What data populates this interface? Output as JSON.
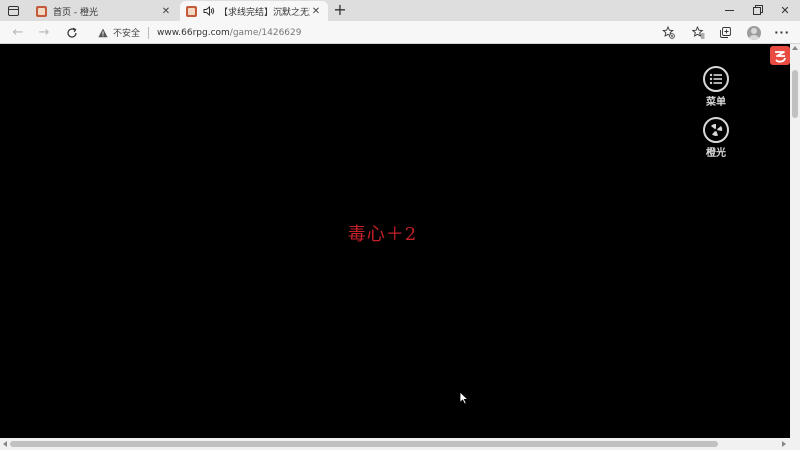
{
  "browser": {
    "tabs": [
      {
        "title": "首页 - 橙光",
        "icon": "orange-light-favicon",
        "active": false
      },
      {
        "title": "【求线完结】沉默之无双",
        "icon": "game-favicon",
        "active": true,
        "audio": true
      }
    ],
    "close_glyph": "✕",
    "new_tab_glyph": "+",
    "window_close_glyph": "✕"
  },
  "toolbar": {
    "back_glyph": "←",
    "forward_glyph": "→",
    "insecure_label": "不安全",
    "url_host": "www.66rpg.com",
    "url_path": "/game/1426629",
    "more_glyph": "···"
  },
  "game": {
    "message": "毒心＋2",
    "message_color": "#c4202a",
    "side_menu_label": "菜单",
    "side_brand_label": "橙光"
  }
}
